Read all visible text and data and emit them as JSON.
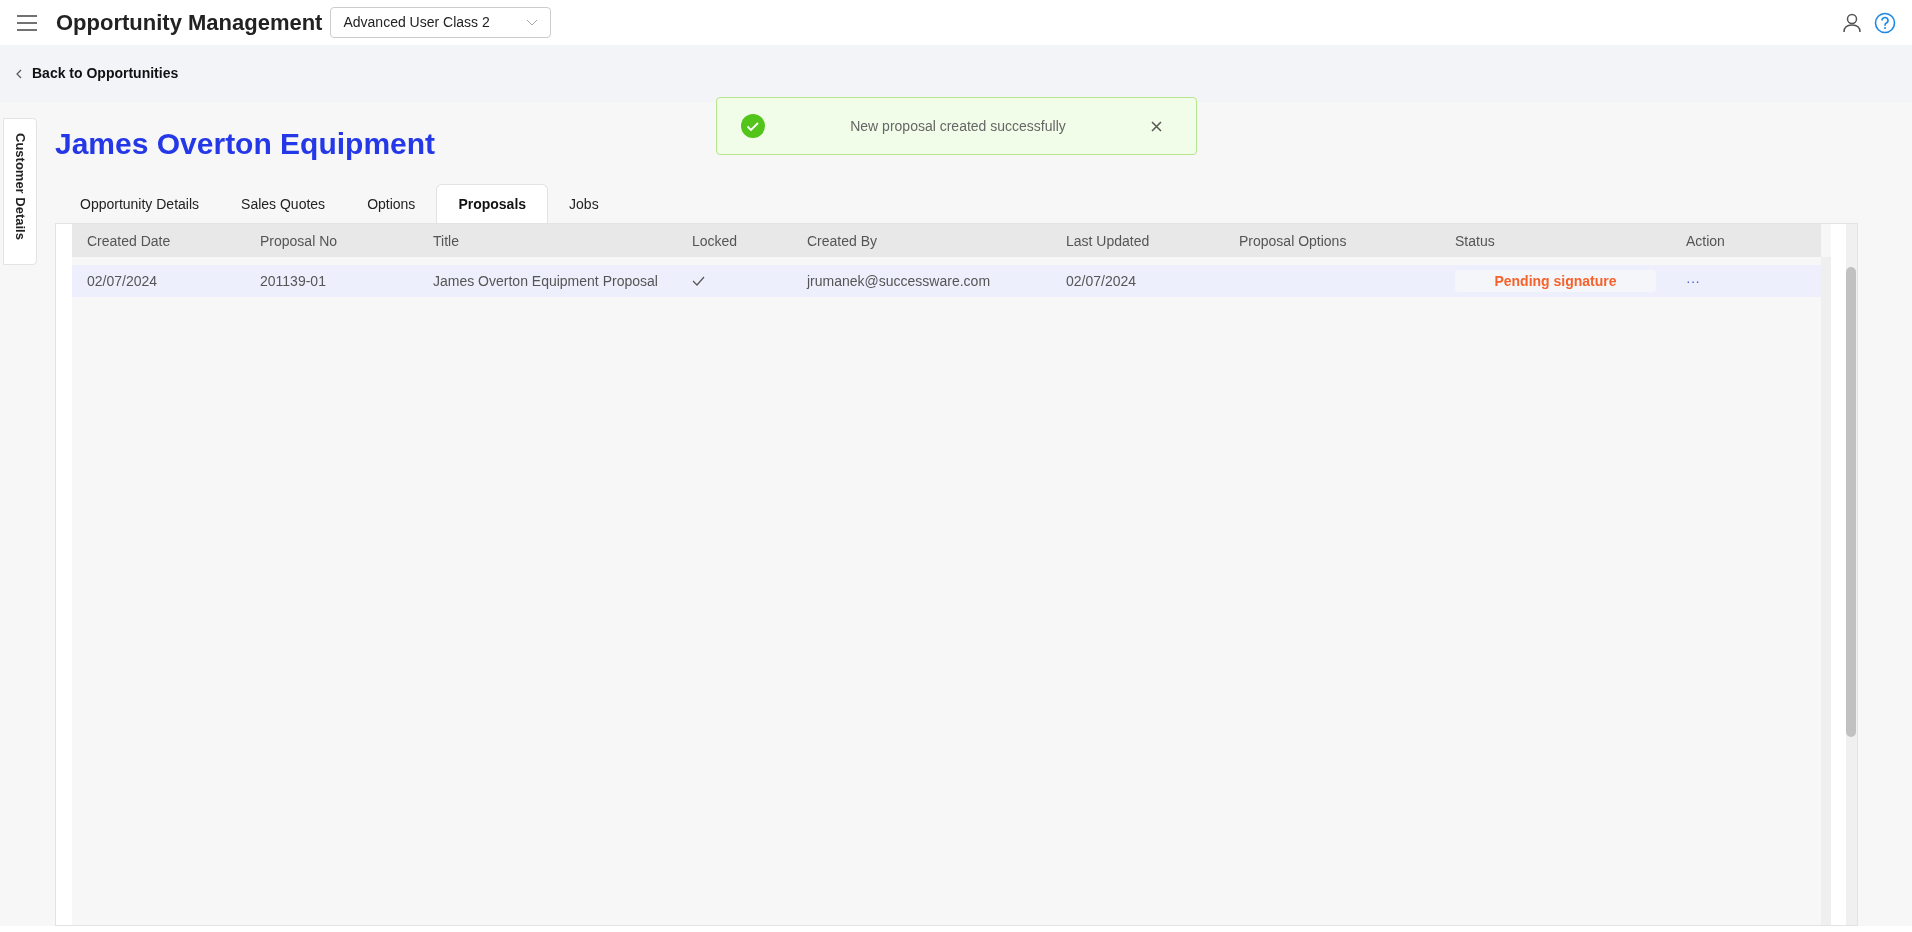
{
  "app_bar": {
    "title": "Opportunity Management",
    "role_select": {
      "value": "Advanced User Class 2"
    }
  },
  "back_link": "Back to Opportunities",
  "side_tab": "Customer Details",
  "customer_title": "James Overton Equipment",
  "toast": {
    "message": "New proposal created successfully"
  },
  "tabs": [
    {
      "label": "Opportunity Details",
      "selected": false
    },
    {
      "label": "Sales Quotes",
      "selected": false
    },
    {
      "label": "Options",
      "selected": false
    },
    {
      "label": "Proposals",
      "selected": true
    },
    {
      "label": "Jobs",
      "selected": false
    }
  ],
  "table": {
    "columns": [
      "Created Date",
      "Proposal No",
      "Title",
      "Locked",
      "Created By",
      "Last Updated",
      "Proposal Options",
      "Status",
      "Action"
    ],
    "rows": [
      {
        "created_date": "02/07/2024",
        "proposal_no": "201139-01",
        "title": "James Overton Equipment Proposal",
        "locked": true,
        "created_by": "jrumanek@successware.com",
        "last_updated": "02/07/2024",
        "status": "Pending signature",
        "action": "···"
      }
    ]
  }
}
